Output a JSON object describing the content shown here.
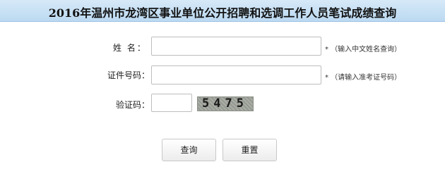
{
  "header": {
    "title": "2016年温州市龙湾区事业单位公开招聘和选调工作人员笔试成绩查询"
  },
  "form": {
    "name": {
      "label": "姓 名：",
      "value": "",
      "hint": "* （输入中文姓名查询）"
    },
    "id_number": {
      "label": "证件号码：",
      "value": "",
      "hint": "* （请输入准考证号码）"
    },
    "captcha": {
      "label": "验证码：",
      "value": "",
      "image_text": "5475"
    }
  },
  "buttons": {
    "query_label": "查询",
    "reset_label": "重置"
  },
  "colors": {
    "title_bar": "#c8e1f5",
    "captcha_bg": "#9ea39a"
  }
}
